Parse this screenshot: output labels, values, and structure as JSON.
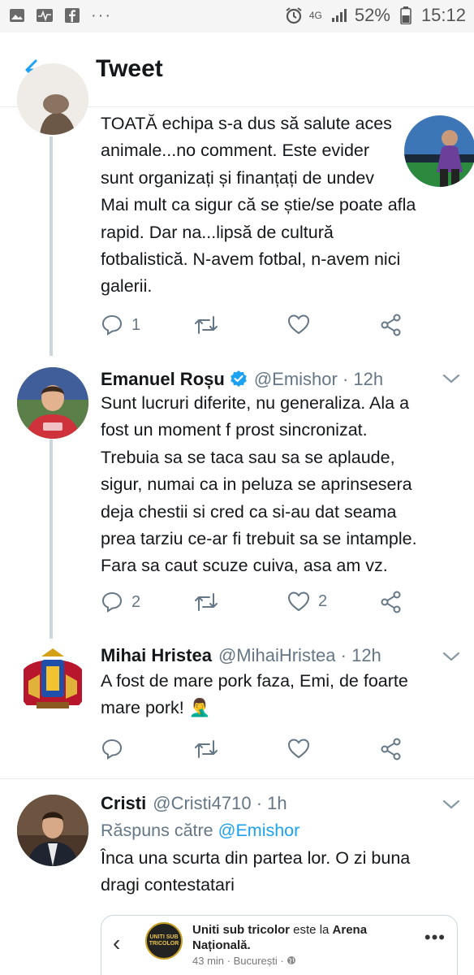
{
  "status_bar": {
    "battery": "52%",
    "time": "15:12",
    "network": "4G",
    "left_icons": [
      "gallery-icon",
      "activity-icon",
      "facebook-icon",
      "more-dots-icon"
    ],
    "right_icons": [
      "alarm-icon",
      "signal-icon",
      "battery-icon"
    ]
  },
  "header": {
    "title": "Tweet",
    "back_icon": "arrow-left-icon"
  },
  "colors": {
    "accent": "#1da1f2",
    "text": "#14171a",
    "secondary": "#657786",
    "divider": "#e6ecf0",
    "verified": "#1da1f2"
  },
  "tweets": [
    {
      "text_lines": [
        "TOATĂ echipa s-a dus să salute aces",
        "animale...no comment. Este evider",
        "sunt organizați și finanțați de undev",
        "Mai mult ca sigur că se știe/se poate afla",
        "rapid. Dar na...lipsă de cultură",
        "fotbalistică. N-avem fotbal, n-avem nici",
        "galerii."
      ],
      "reply_count": "1",
      "retweet_count": "",
      "like_count": ""
    },
    {
      "name": "Emanuel Roșu",
      "handle": "@Emishor · 12h",
      "verified": true,
      "text_lines": [
        "Sunt lucruri diferite, nu generaliza. Ala a",
        "fost un moment f prost sincronizat.",
        "Trebuia sa se taca sau sa se aplaude,",
        "sigur, numai ca in peluza se aprinsesera",
        "deja chestii si cred ca si-au dat seama",
        "prea tarziu ce-ar fi trebuit sa se intample.",
        "Fara sa caut scuze cuiva, asa am vz."
      ],
      "reply_count": "2",
      "retweet_count": "",
      "like_count": "2"
    },
    {
      "name": "Mihai Hristea",
      "handle": "@MihaiHristea · 12h",
      "verified": false,
      "text_lines": [
        "A fost de mare pork faza, Emi, de foarte",
        "mare pork! 🤦‍♂️"
      ],
      "reply_count": "",
      "retweet_count": "",
      "like_count": ""
    },
    {
      "name": "Cristi",
      "handle": "@Cristi4710 · 1h",
      "verified": false,
      "reply_to_label": "Răspuns către",
      "reply_to_handle": "@Emishor",
      "text_lines": [
        "Înca una scurta din partea lor. O zi buna",
        "dragi contestatari"
      ]
    }
  ],
  "embed_card": {
    "logo_text": "UNITI SUB TRICOLOR",
    "page_name": "Uniti sub tricolor",
    "middle_text": "este la",
    "place": "Arena Națională.",
    "sub": "43 min · București ·",
    "more": "•••"
  }
}
